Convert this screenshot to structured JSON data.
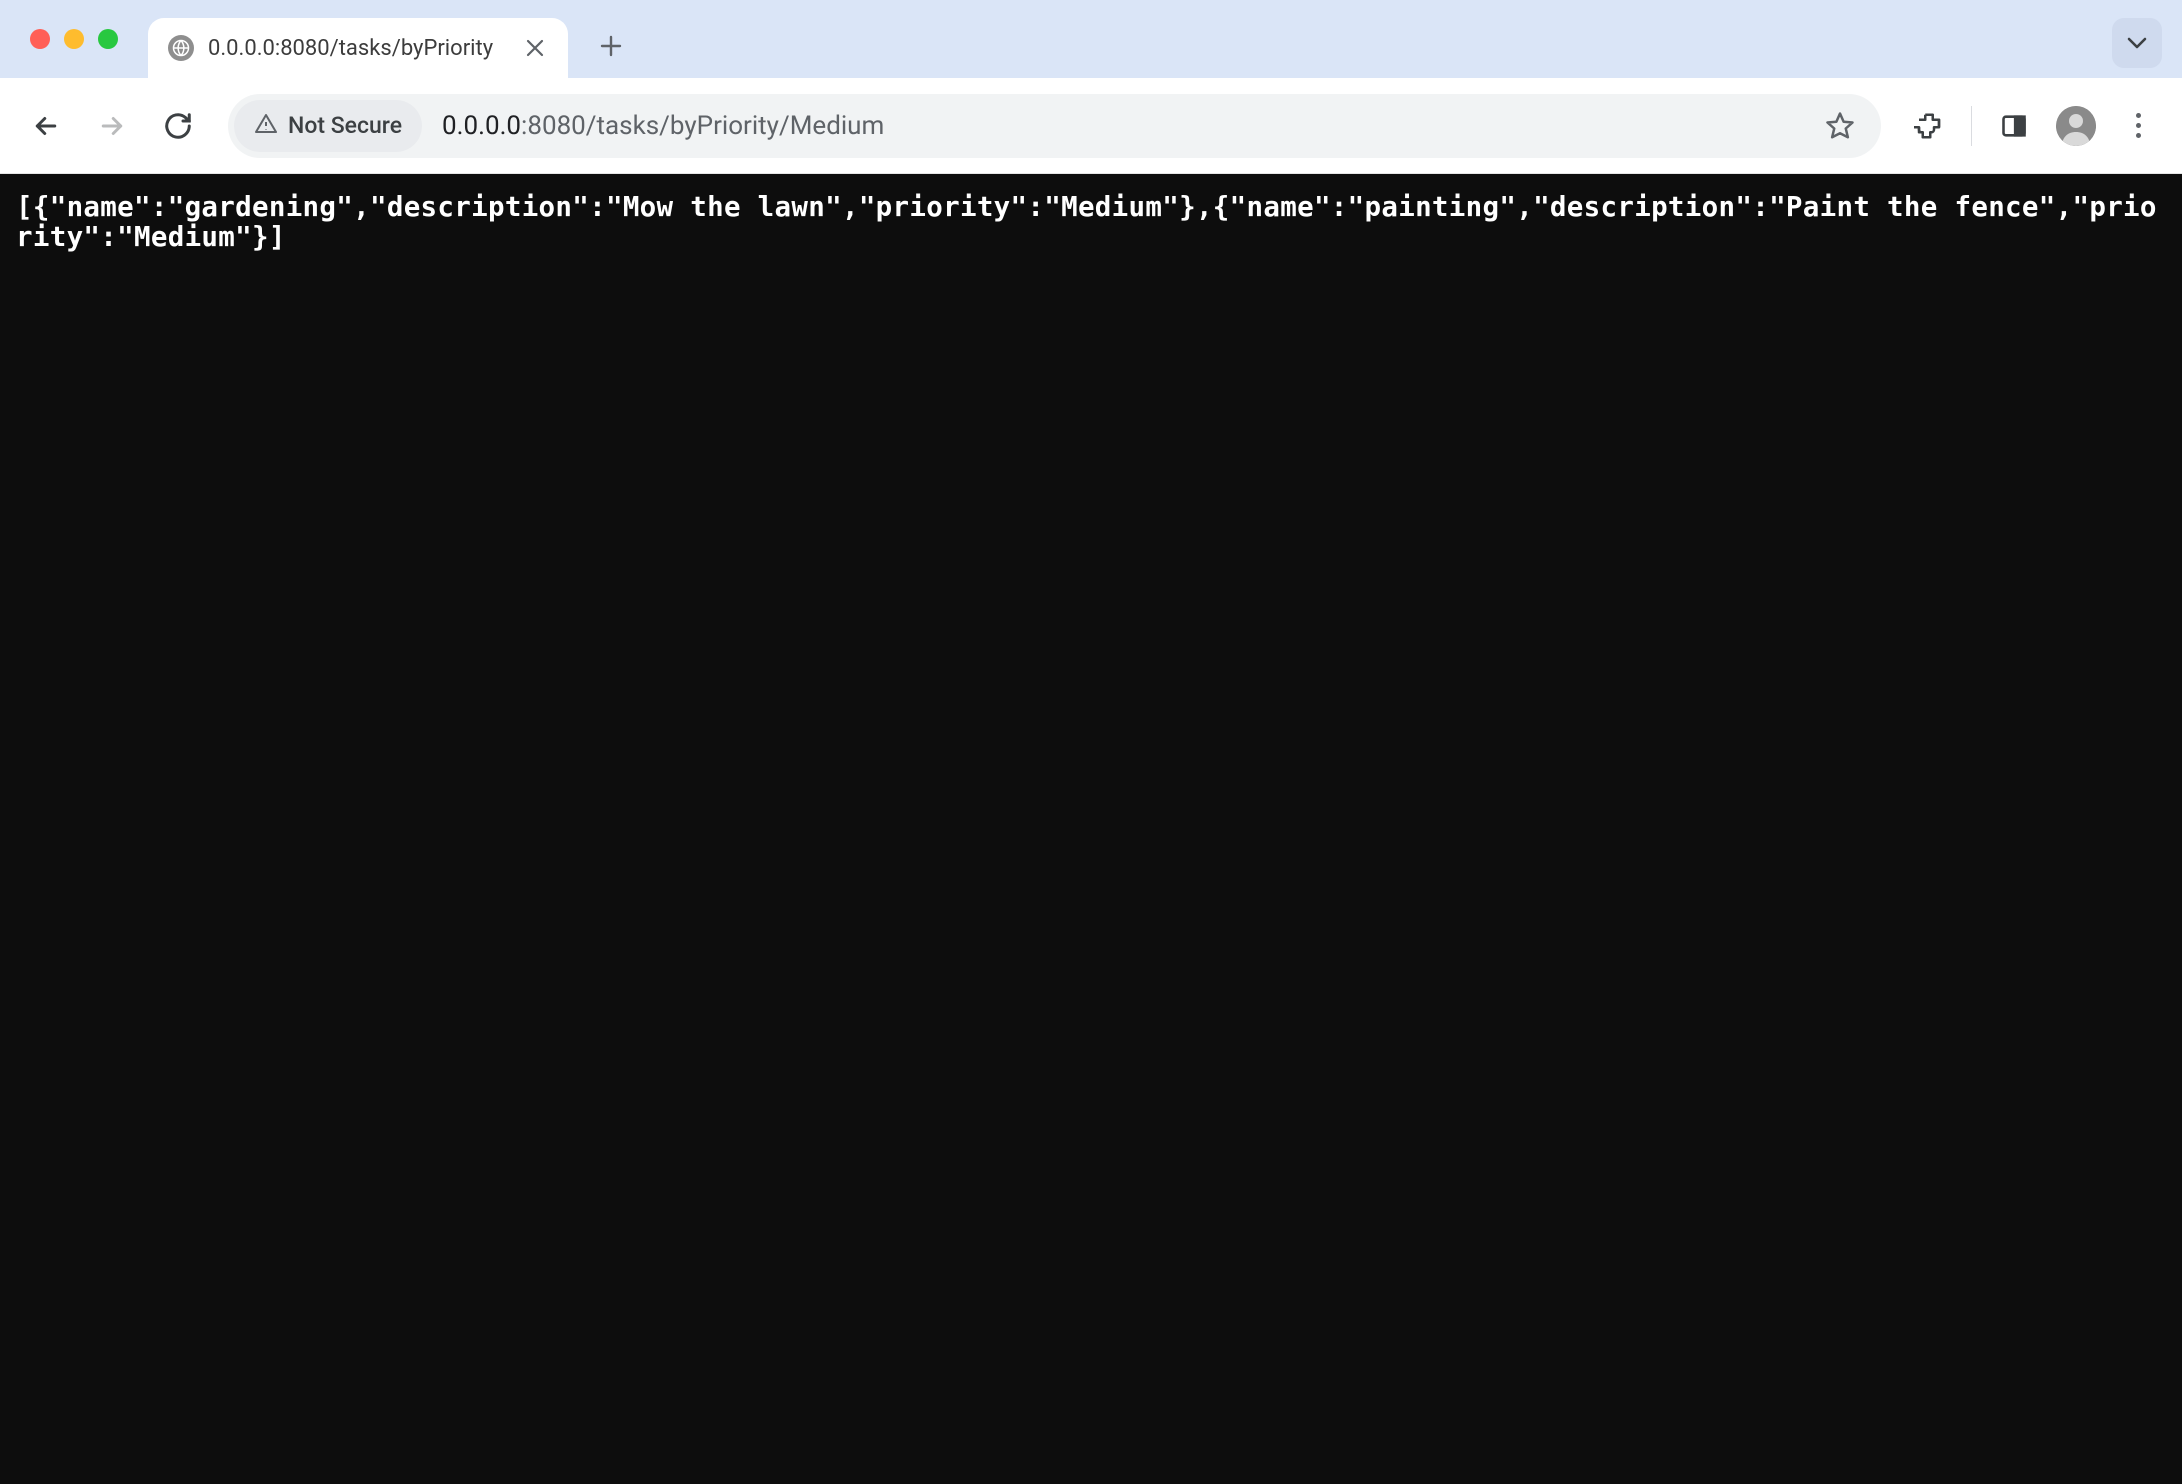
{
  "tab": {
    "title": "0.0.0.0:8080/tasks/byPriority"
  },
  "address": {
    "security_label": "Not Secure",
    "host": "0.0.0.0",
    "path": ":8080/tasks/byPriority/Medium"
  },
  "page_content": {
    "raw": "[{\"name\":\"gardening\",\"description\":\"Mow the lawn\",\"priority\":\"Medium\"},{\"name\":\"painting\",\"description\":\"Paint the fence\",\"priority\":\"Medium\"}]",
    "json": [
      {
        "name": "gardening",
        "description": "Mow the lawn",
        "priority": "Medium"
      },
      {
        "name": "painting",
        "description": "Paint the fence",
        "priority": "Medium"
      }
    ]
  }
}
